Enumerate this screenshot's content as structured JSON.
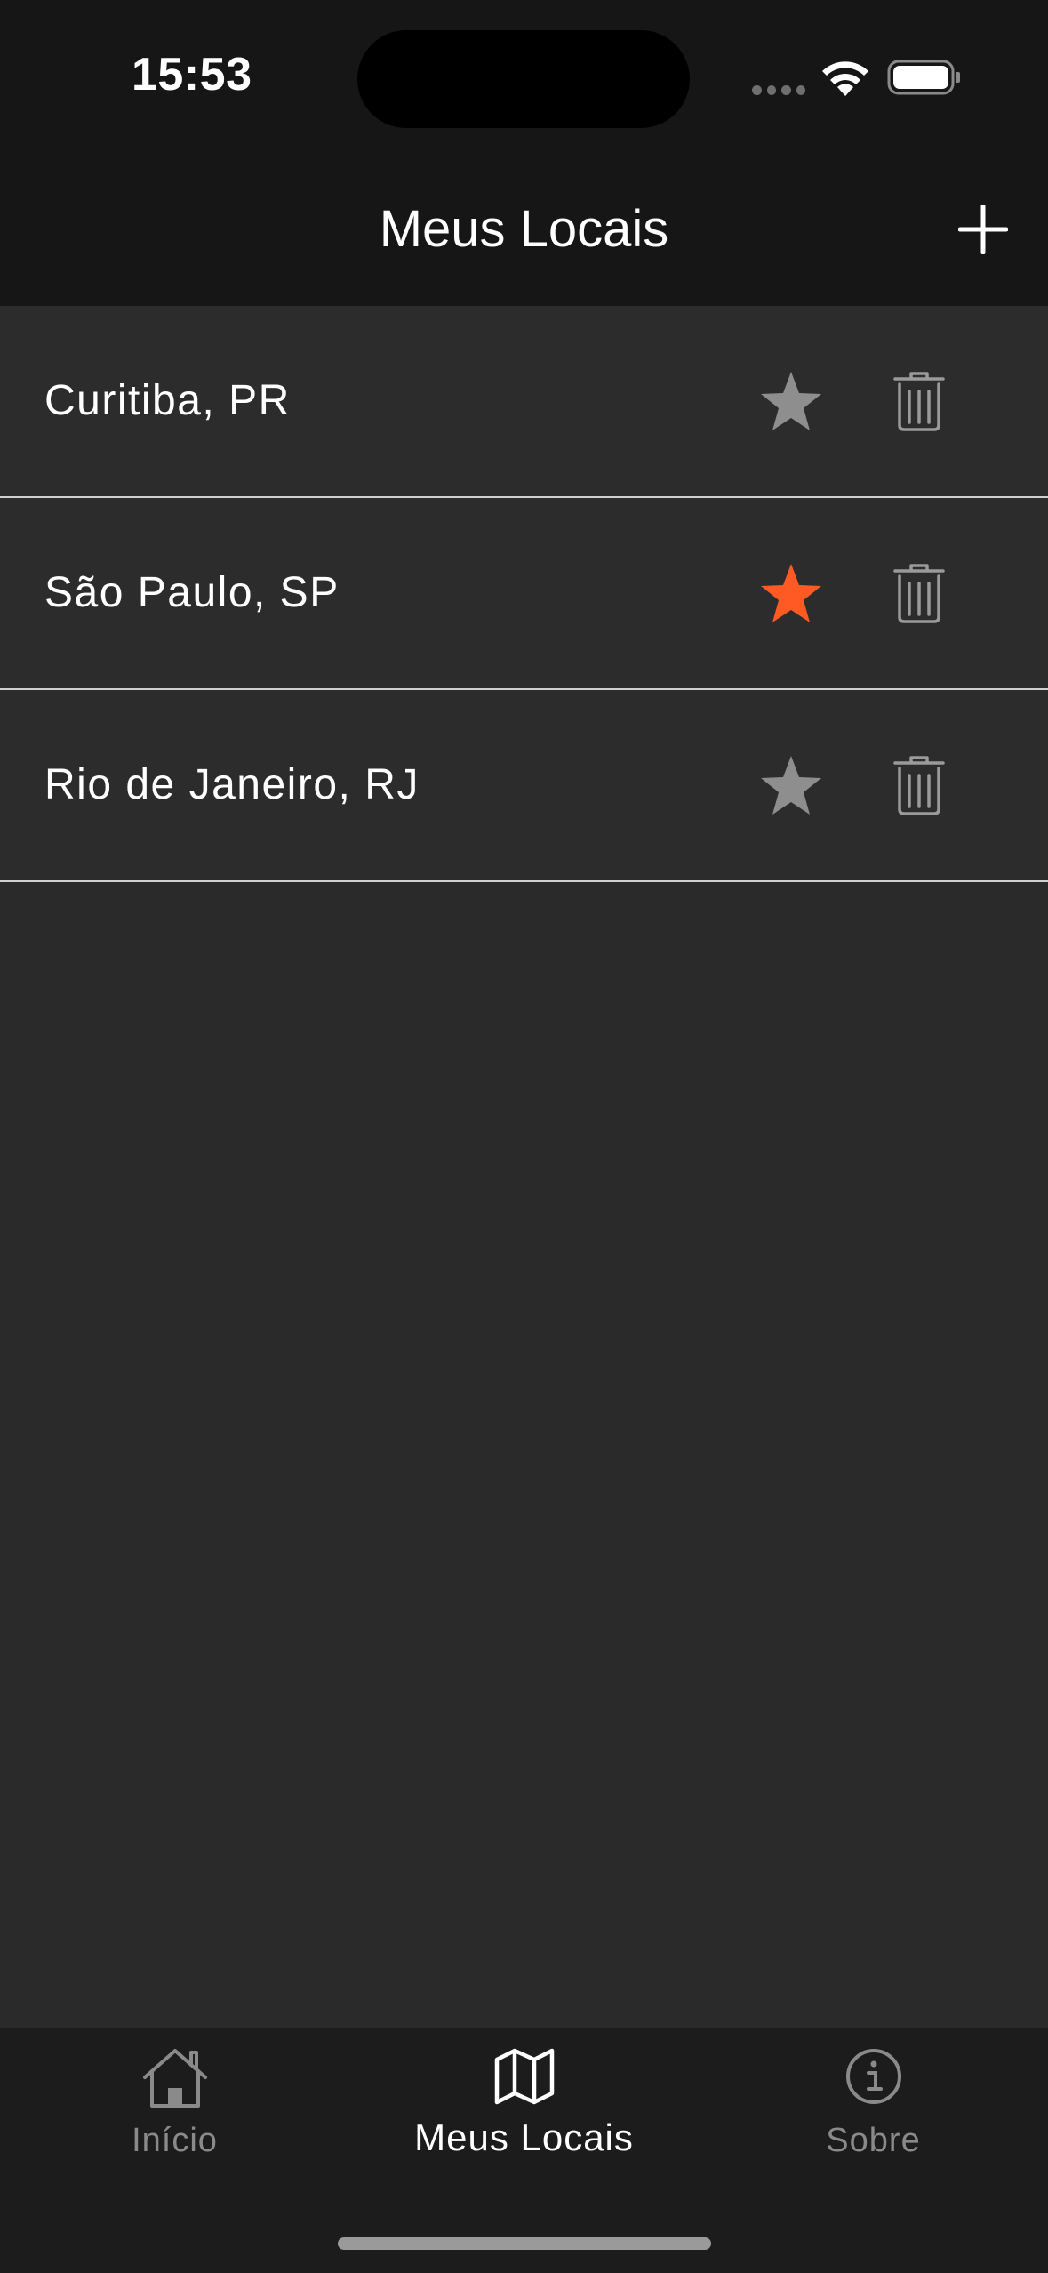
{
  "status_bar": {
    "time": "15:53"
  },
  "header": {
    "title": "Meus Locais",
    "add_icon": "plus-icon"
  },
  "locations": [
    {
      "name": "Curitiba, PR",
      "favorite": false
    },
    {
      "name": "São Paulo, SP",
      "favorite": true
    },
    {
      "name": "Rio de Janeiro, RJ",
      "favorite": false
    }
  ],
  "tabs": [
    {
      "label": "Início",
      "icon": "house-icon",
      "active": false
    },
    {
      "label": "Meus Locais",
      "icon": "map-icon",
      "active": true
    },
    {
      "label": "Sobre",
      "icon": "info-icon",
      "active": false
    }
  ],
  "colors": {
    "favorite_active": "#ff5a24",
    "favorite_inactive": "#8e8e8e",
    "background": "#2a2a2a",
    "bars": "#161616"
  }
}
